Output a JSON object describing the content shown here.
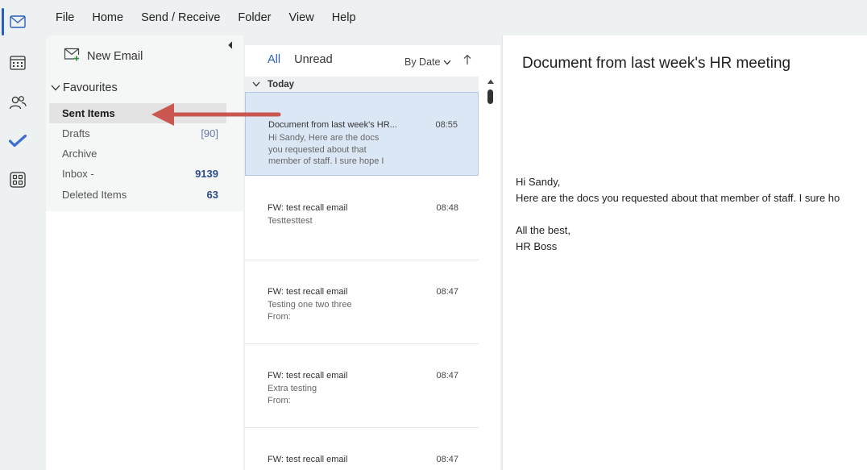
{
  "rail": {
    "items": [
      {
        "icon": "mail-icon"
      },
      {
        "icon": "calendar-icon"
      },
      {
        "icon": "people-icon"
      },
      {
        "icon": "todo-check-icon"
      },
      {
        "icon": "apps-icon"
      }
    ],
    "accent": "#2b5fb8"
  },
  "menu": {
    "items": [
      "File",
      "Home",
      "Send / Receive",
      "Folder",
      "View",
      "Help"
    ]
  },
  "folders": {
    "new_email_label": "New Email",
    "favourites_label": "Favourites",
    "items": [
      {
        "label": "Sent Items",
        "count": ""
      },
      {
        "label": "Drafts",
        "count": "[90]"
      },
      {
        "label": "Archive",
        "count": ""
      },
      {
        "label": "Inbox -",
        "count": "9139"
      },
      {
        "label": "Deleted Items",
        "count": "63"
      }
    ]
  },
  "list": {
    "tab_all": "All",
    "tab_unread": "Unread",
    "sort_label": "By Date",
    "group_today": "Today",
    "messages": [
      {
        "subject": "Document from last week's HR...",
        "time": "08:55",
        "preview": [
          "Hi Sandy,  Here are the docs",
          "you requested about that",
          "member of staff. I sure hope I"
        ]
      },
      {
        "subject": "FW: test recall email",
        "time": "08:48",
        "preview": [
          "Testtesttest"
        ]
      },
      {
        "subject": "FW: test recall email",
        "time": "08:47",
        "preview": [
          "Testing one two three",
          "From:"
        ]
      },
      {
        "subject": "FW: test recall email",
        "time": "08:47",
        "preview": [
          "Extra testing",
          "From:"
        ]
      },
      {
        "subject": "FW: test recall email",
        "time": "08:47",
        "preview": []
      }
    ]
  },
  "reading": {
    "subject": "Document from last week's HR meeting",
    "body": [
      "Hi Sandy,",
      "Here are the docs you requested about that member of staff. I sure ho",
      "",
      "All the best,",
      "HR Boss"
    ]
  },
  "colors": {
    "annotation_arrow": "#c9574f",
    "selected_message_bg": "#dce7f6"
  }
}
